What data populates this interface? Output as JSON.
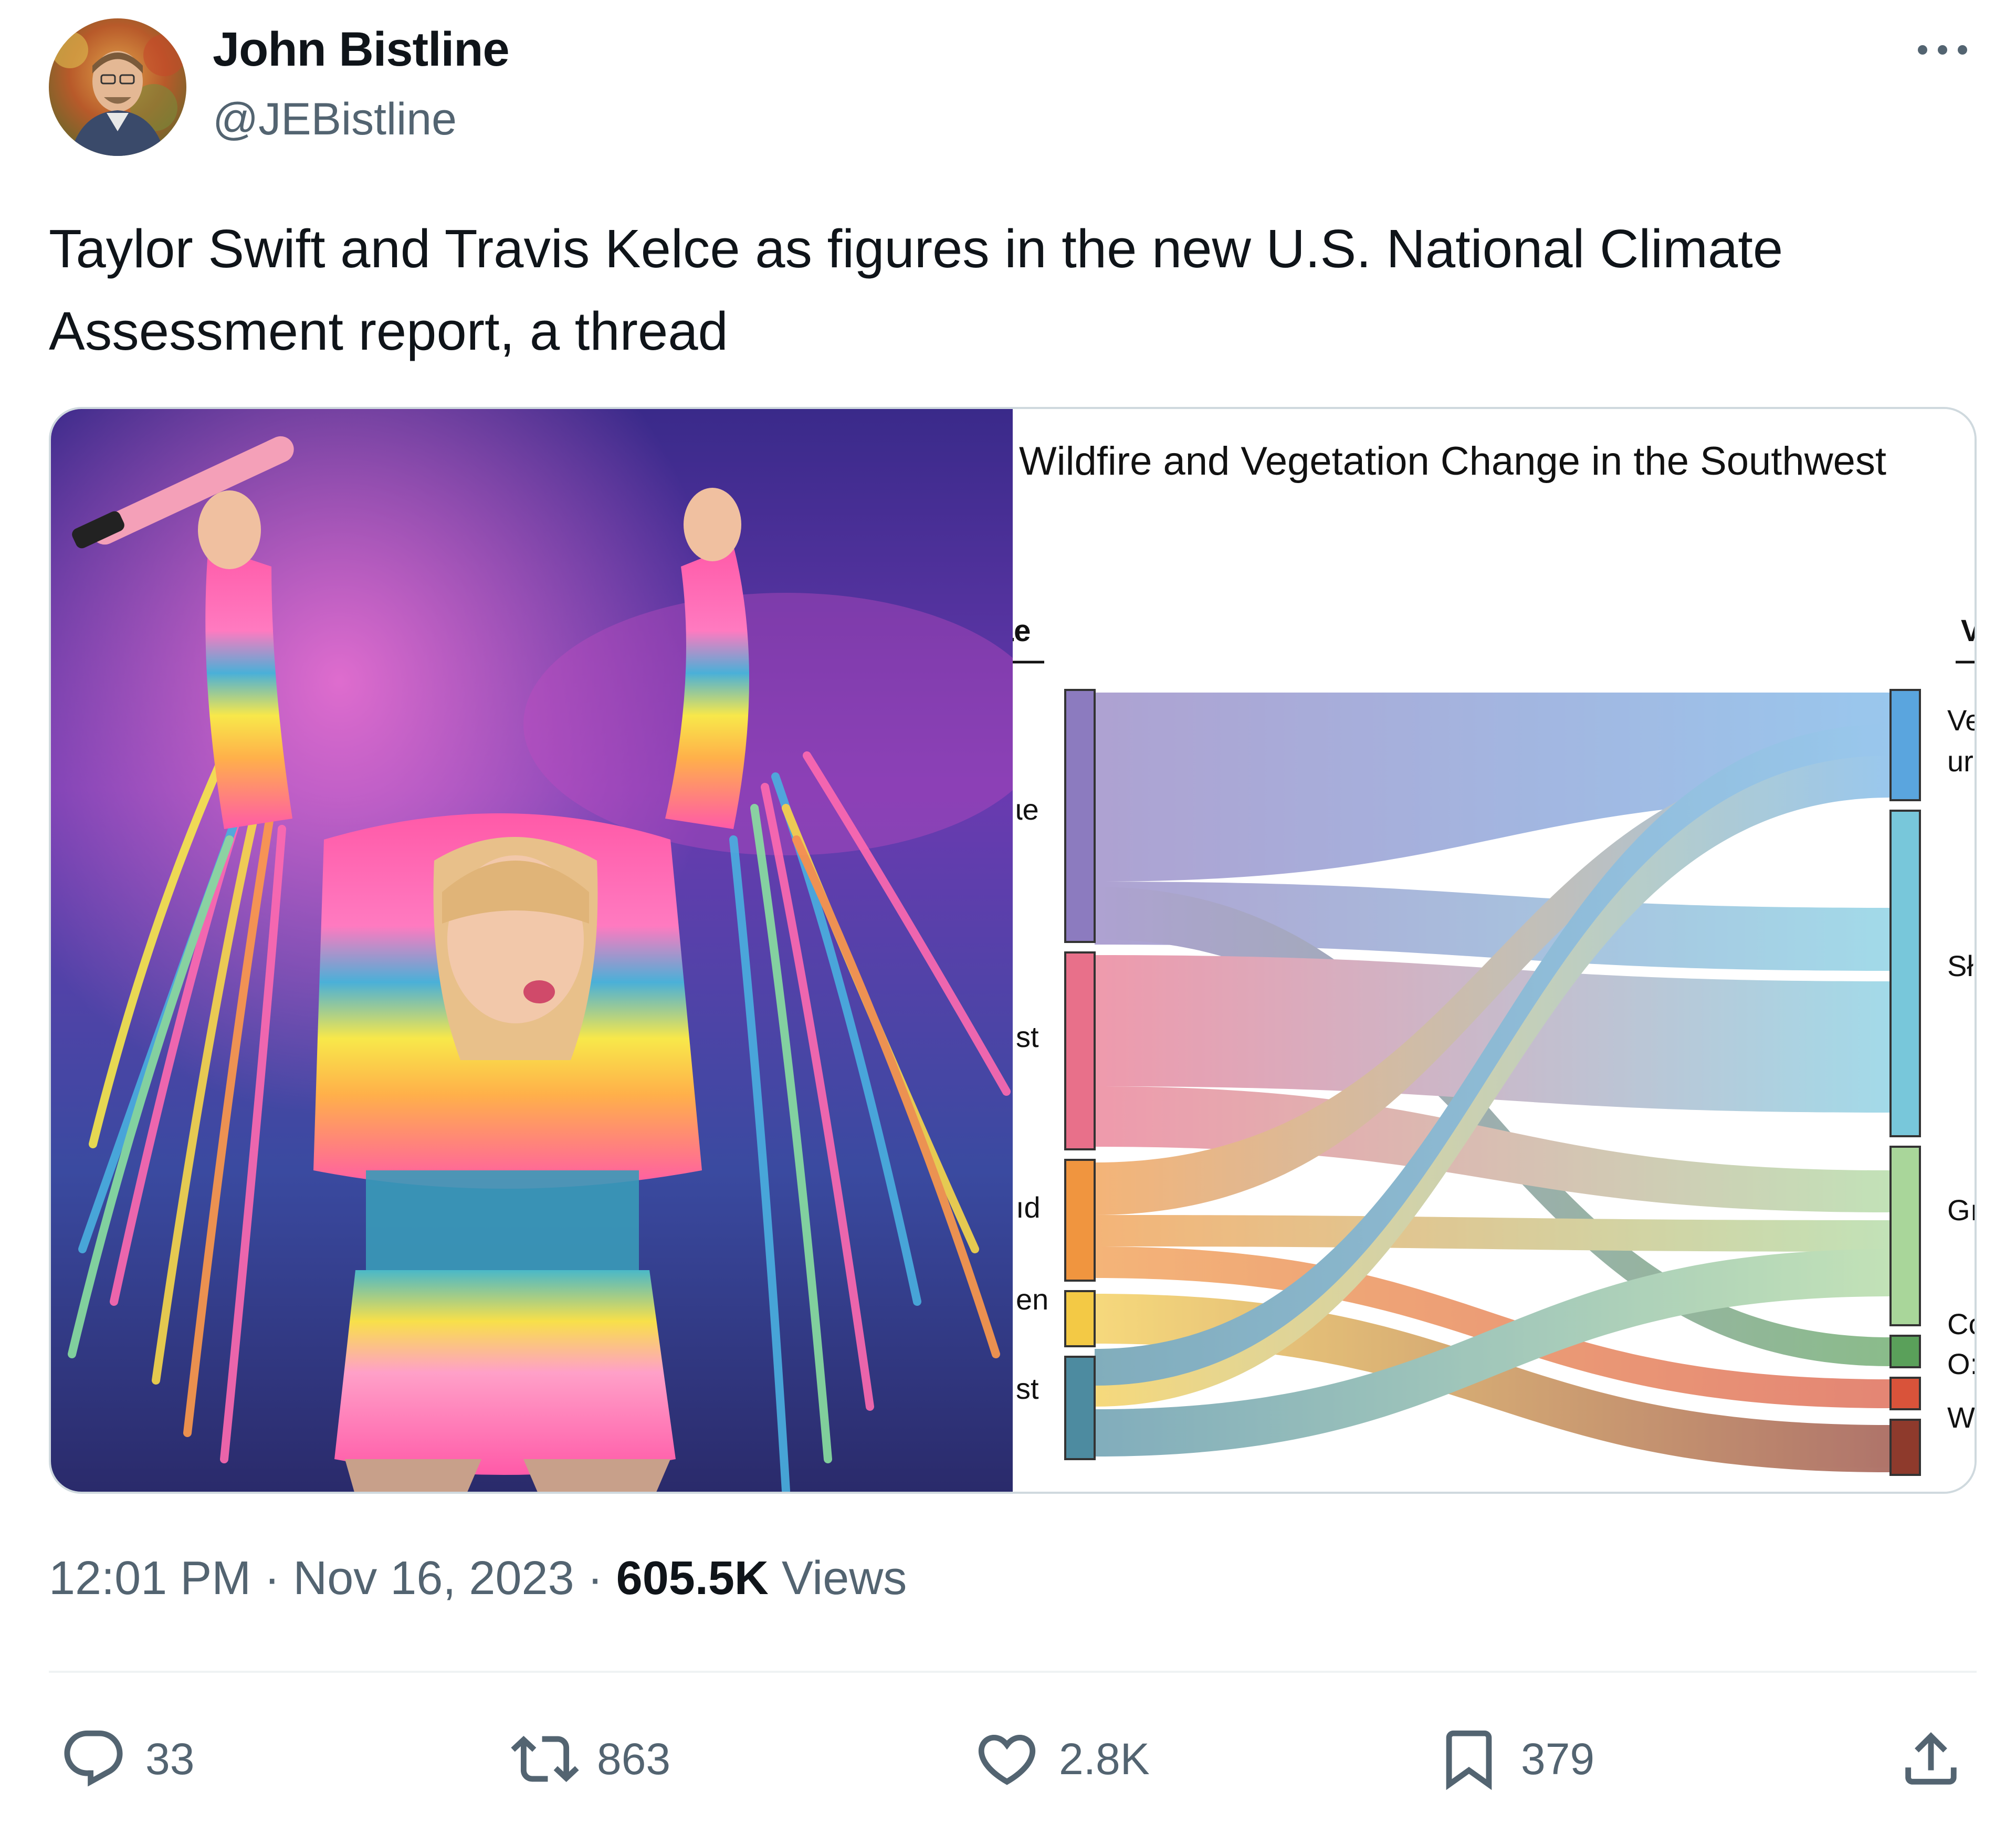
{
  "author": {
    "display_name": "John Bistline",
    "handle": "@JEBistline"
  },
  "tweet": {
    "text": "Taylor Swift and Travis Kelce as figures in the new U.S. National Climate Assessment report, a thread",
    "time": "12:01 PM",
    "date": "Nov 16, 2023",
    "separator": "·",
    "views_count": "605.5K",
    "views_label": "Views"
  },
  "embedded_chart": {
    "title": "Wildfire and Vegetation Change in the Southwest",
    "left_header": "ɩe",
    "right_header": "V",
    "left_labels": [
      "ɩe",
      "st",
      "ıd",
      "en",
      "st"
    ],
    "right_labels": [
      "Ve",
      "ur",
      "Sł",
      "Gı",
      "Cc",
      "O:",
      "W"
    ],
    "colors": {
      "purple": "#8c7bbf",
      "pink": "#e8708a",
      "orange": "#f0953f",
      "yellow": "#f3c945",
      "teal": "#4d8ba0",
      "blue": "#5aa5de",
      "cyan": "#78c7da",
      "green_light": "#a9d69a",
      "green": "#5aa05a",
      "red": "#d9533a",
      "brown": "#8e3a2c"
    }
  },
  "actions": {
    "reply_count": "33",
    "retweet_count": "863",
    "like_count": "2.8K",
    "bookmark_count": "379"
  },
  "icons": [
    "more-icon",
    "reply-icon",
    "retweet-icon",
    "like-icon",
    "bookmark-icon",
    "share-icon"
  ],
  "colors": {
    "text_primary": "#0f1419",
    "text_secondary": "#536471",
    "border": "#cfd9de"
  }
}
